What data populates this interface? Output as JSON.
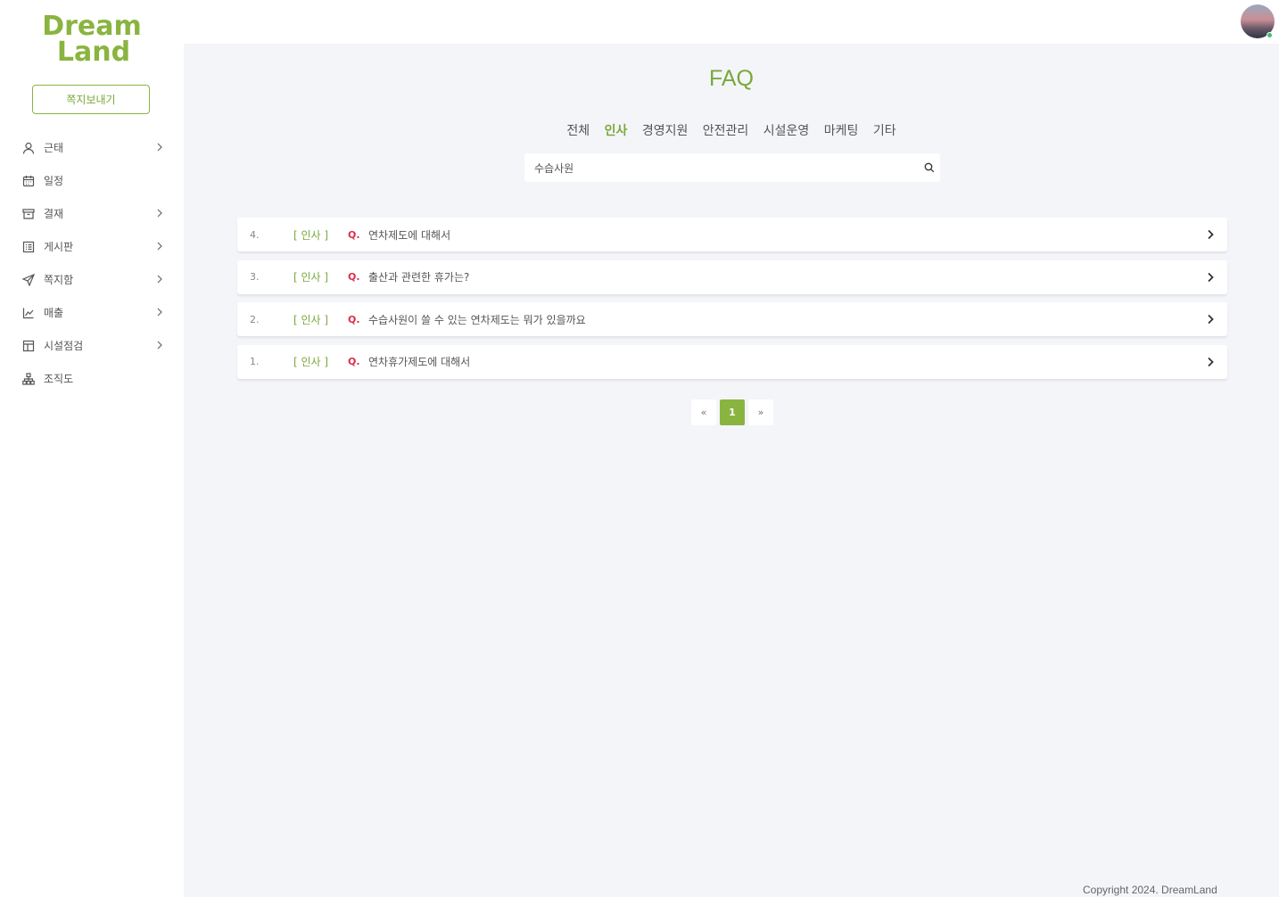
{
  "sidebar": {
    "logo": {
      "line1": "Dream",
      "line2": "Land"
    },
    "send_button": "쪽지보내기",
    "items": [
      {
        "label": "근태",
        "icon": "user-icon",
        "has_sub": true
      },
      {
        "label": "일정",
        "icon": "calendar-icon",
        "has_sub": false
      },
      {
        "label": "결재",
        "icon": "archive-icon",
        "has_sub": true
      },
      {
        "label": "게시판",
        "icon": "list-board-icon",
        "has_sub": true
      },
      {
        "label": "쪽지함",
        "icon": "send-icon",
        "has_sub": true
      },
      {
        "label": "매출",
        "icon": "chart-line-icon",
        "has_sub": true
      },
      {
        "label": "시설점검",
        "icon": "layout-icon",
        "has_sub": true
      },
      {
        "label": "조직도",
        "icon": "org-chart-icon",
        "has_sub": false
      }
    ]
  },
  "page": {
    "title": "FAQ"
  },
  "categories": [
    {
      "label": "전체",
      "active": false
    },
    {
      "label": "인사",
      "active": true
    },
    {
      "label": "경영지원",
      "active": false
    },
    {
      "label": "안전관리",
      "active": false
    },
    {
      "label": "시설운영",
      "active": false
    },
    {
      "label": "마케팅",
      "active": false
    },
    {
      "label": "기타",
      "active": false
    }
  ],
  "search": {
    "value": "수습사원",
    "placeholder": ""
  },
  "faqs": [
    {
      "num": "4.",
      "category": "[ 인사 ]",
      "q": "Q.",
      "text": "연차제도에 대해서"
    },
    {
      "num": "3.",
      "category": "[ 인사 ]",
      "q": "Q.",
      "text": "출산과 관련한 휴가는?"
    },
    {
      "num": "2.",
      "category": "[ 인사 ]",
      "q": "Q.",
      "text": "수습사원이 쓸 수 있는 연차제도는 뭐가 있을까요"
    },
    {
      "num": "1.",
      "category": "[ 인사 ]",
      "q": "Q.",
      "text": "연차휴가제도에 대해서"
    }
  ],
  "pagination": {
    "prev": "«",
    "current": "1",
    "next": "»"
  },
  "footer": {
    "copyright": "Copyright 2024. DreamLand"
  },
  "colors": {
    "accent": "#8ab440",
    "question": "#d9304b",
    "background": "#f4f5f9"
  }
}
